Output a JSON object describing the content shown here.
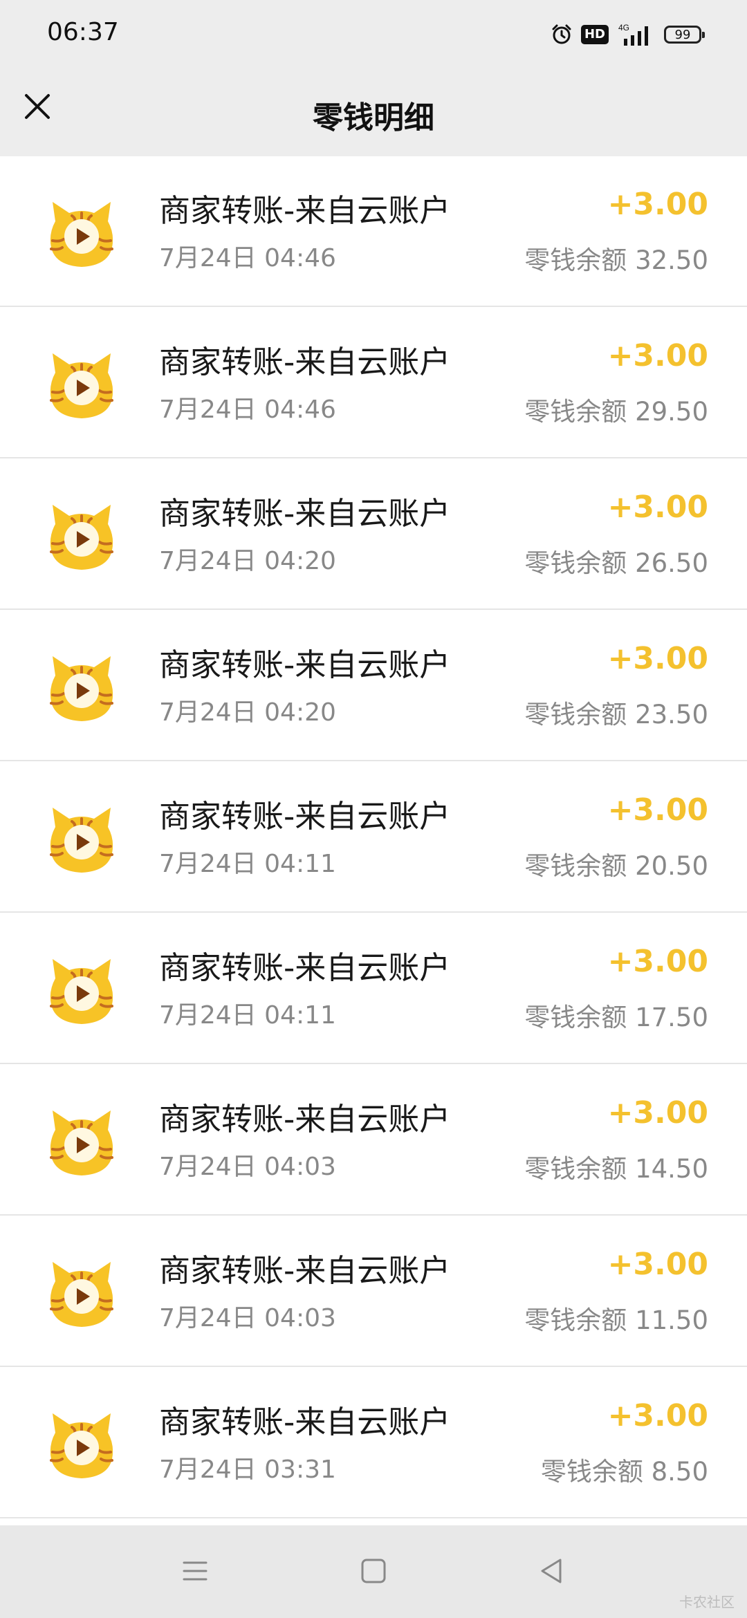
{
  "status_bar": {
    "time": "06:37",
    "hd_label": "HD",
    "network_label": "4G",
    "battery_level": "99"
  },
  "header": {
    "title": "零钱明细",
    "close_icon": "close-icon"
  },
  "colors": {
    "amount": "#f4c12e",
    "avatar_body": "#f7c326",
    "avatar_stripe": "#c46c1f"
  },
  "transactions": [
    {
      "title": "商家转账-来自云账户",
      "time": "7月24日 04:46",
      "amount": "+3.00",
      "balance": "零钱余额 32.50"
    },
    {
      "title": "商家转账-来自云账户",
      "time": "7月24日 04:46",
      "amount": "+3.00",
      "balance": "零钱余额 29.50"
    },
    {
      "title": "商家转账-来自云账户",
      "time": "7月24日 04:20",
      "amount": "+3.00",
      "balance": "零钱余额 26.50"
    },
    {
      "title": "商家转账-来自云账户",
      "time": "7月24日 04:20",
      "amount": "+3.00",
      "balance": "零钱余额 23.50"
    },
    {
      "title": "商家转账-来自云账户",
      "time": "7月24日 04:11",
      "amount": "+3.00",
      "balance": "零钱余额 20.50"
    },
    {
      "title": "商家转账-来自云账户",
      "time": "7月24日 04:11",
      "amount": "+3.00",
      "balance": "零钱余额 17.50"
    },
    {
      "title": "商家转账-来自云账户",
      "time": "7月24日 04:03",
      "amount": "+3.00",
      "balance": "零钱余额 14.50"
    },
    {
      "title": "商家转账-来自云账户",
      "time": "7月24日 04:03",
      "amount": "+3.00",
      "balance": "零钱余额 11.50"
    },
    {
      "title": "商家转账-来自云账户",
      "time": "7月24日 03:31",
      "amount": "+3.00",
      "balance": "零钱余额 8.50"
    }
  ],
  "bottom_nav": {
    "menu_icon": "menu-icon",
    "home_icon": "home-icon",
    "back_icon": "back-icon"
  },
  "watermark": "卡农社区"
}
